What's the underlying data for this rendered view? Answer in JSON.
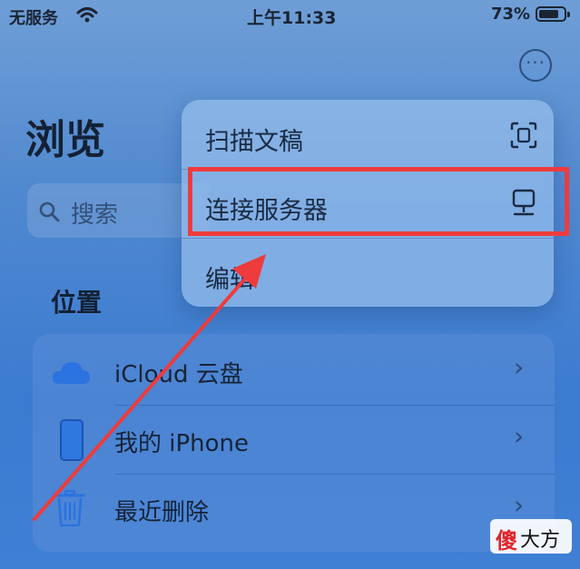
{
  "status_bar": {
    "carrier": "无服务",
    "time": "上午11:33",
    "battery": "73%"
  },
  "header": {
    "title": "浏览",
    "more_icon": "ellipsis-circle-icon"
  },
  "search": {
    "placeholder": "搜索"
  },
  "locations": {
    "header": "位置",
    "items": [
      {
        "label": "iCloud 云盘",
        "icon": "cloud-icon"
      },
      {
        "label": "我的 iPhone",
        "icon": "phone-icon"
      },
      {
        "label": "最近删除",
        "icon": "trash-icon"
      }
    ]
  },
  "menu": {
    "items": [
      {
        "label": "扫描文稿",
        "icon": "scan-document-icon"
      },
      {
        "label": "连接服务器",
        "icon": "server-icon"
      },
      {
        "label": "编辑",
        "icon": ""
      }
    ]
  },
  "annotation": {
    "highlight_color": "#ee3b3b"
  },
  "watermark": {
    "char1": "傻",
    "rest": "大方"
  }
}
